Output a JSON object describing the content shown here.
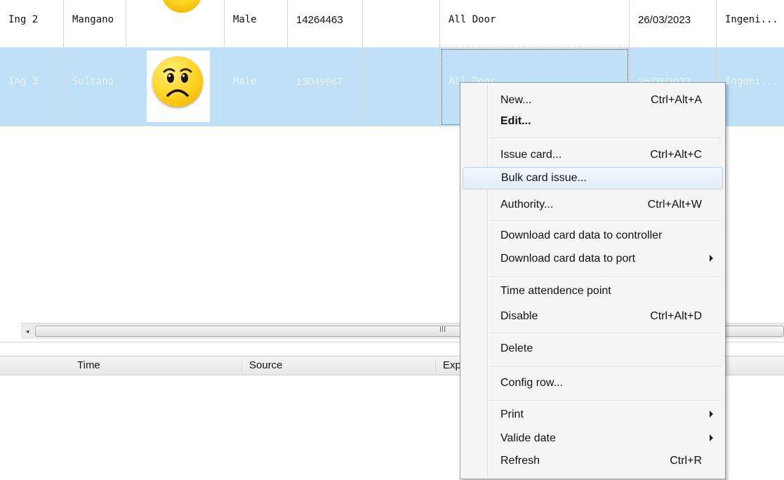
{
  "rows": [
    {
      "id": "Ing 2",
      "name": "Mangano",
      "sex": "Male",
      "card": "14264463",
      "door": "All Door",
      "date": "26/03/2023",
      "dept": "Ingeni..."
    },
    {
      "id": "Ing 3",
      "name": "Sultano",
      "sex": "Male",
      "card": "13049967",
      "door": "All Door",
      "date": "26/03/2023",
      "dept": "Ingeni...",
      "selected": true
    }
  ],
  "scrollbar": {
    "left_arrow": "◂",
    "grip": "III"
  },
  "status_columns": [
    "Time",
    "Source",
    "Exp"
  ],
  "menu": {
    "items": [
      {
        "label": "New...",
        "shortcut": "Ctrl+Alt+A"
      },
      {
        "label": "Edit...",
        "bold": true
      },
      {
        "label": "Issue card...",
        "shortcut": "Ctrl+Alt+C"
      },
      {
        "label": "Bulk card issue...",
        "highlighted": true
      },
      {
        "label": "Authority...",
        "shortcut": "Ctrl+Alt+W"
      },
      {
        "label": "Download card data to controller"
      },
      {
        "label": "Download card data to port",
        "submenu": true
      },
      {
        "label": "Time attendence point"
      },
      {
        "label": "Disable",
        "shortcut": "Ctrl+Alt+D"
      },
      {
        "label": "Delete"
      },
      {
        "label": "Config row..."
      },
      {
        "label": "Print",
        "submenu": true
      },
      {
        "label": "Valide date",
        "submenu": true
      },
      {
        "label": "Refresh",
        "shortcut": "Ctrl+R"
      }
    ]
  },
  "icons": {
    "happy": "smiley-happy-icon",
    "sad": "smiley-sad-icon",
    "submenu": "submenu-arrow-icon"
  },
  "colors": {
    "selection": "#bfe0f7",
    "menu_highlight": "#e2edf9"
  }
}
